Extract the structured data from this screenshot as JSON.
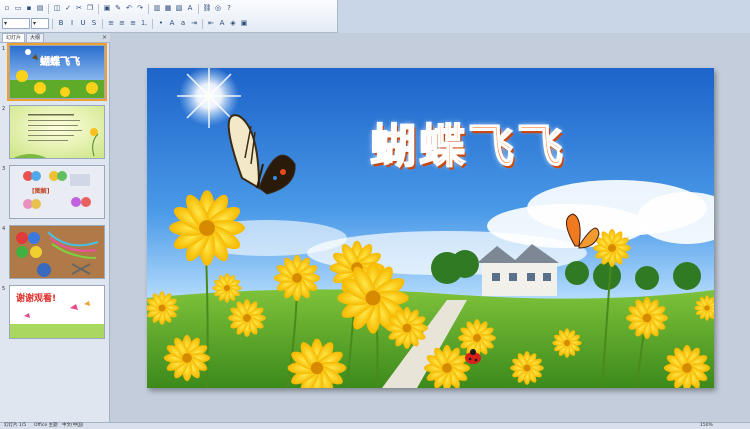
{
  "toolbar": {
    "row1_icons": [
      "new-icon",
      "open-icon",
      "save-icon",
      "print-icon",
      "preview-icon",
      "spellcheck-icon",
      "cut-icon",
      "copy-icon",
      "paste-icon",
      "format-painter-icon",
      "undo-icon",
      "redo-icon",
      "insert-chart-icon",
      "insert-table-icon",
      "insert-picture-icon",
      "wordart-icon",
      "hyperlink-icon",
      "zoom-icon",
      "help-icon"
    ],
    "row2_icons": [
      "bold-icon",
      "italic-icon",
      "underline-icon",
      "shadow-icon",
      "align-left-icon",
      "align-center-icon",
      "align-right-icon",
      "numbering-icon",
      "bullets-icon",
      "increase-font-icon",
      "decrease-font-icon",
      "indent-icon",
      "outdent-icon",
      "font-color-icon",
      "design-icon",
      "new-slide-icon"
    ]
  },
  "left_panel": {
    "tabs": [
      "幻灯片",
      "大纲"
    ],
    "active_tab": 0,
    "close_glyph": "×",
    "thumbnails": [
      {
        "number": "1",
        "title": "蝴蝶飞飞"
      },
      {
        "number": "2"
      },
      {
        "number": "3",
        "title": "[图解]"
      },
      {
        "number": "4"
      },
      {
        "number": "5",
        "title": "谢谢观看!"
      }
    ]
  },
  "slide": {
    "title": "蝴蝶飞飞"
  },
  "status_bar": {
    "slide_info": "幻灯片 1/5",
    "theme": "Office 主题",
    "language": "中文(中国)",
    "zoom": "150%"
  },
  "colors": {
    "accent": "#f0a030",
    "title_orange": "#ff7a2a",
    "sky_top": "#1d63c9",
    "petal_yellow": "#ffd21a"
  }
}
